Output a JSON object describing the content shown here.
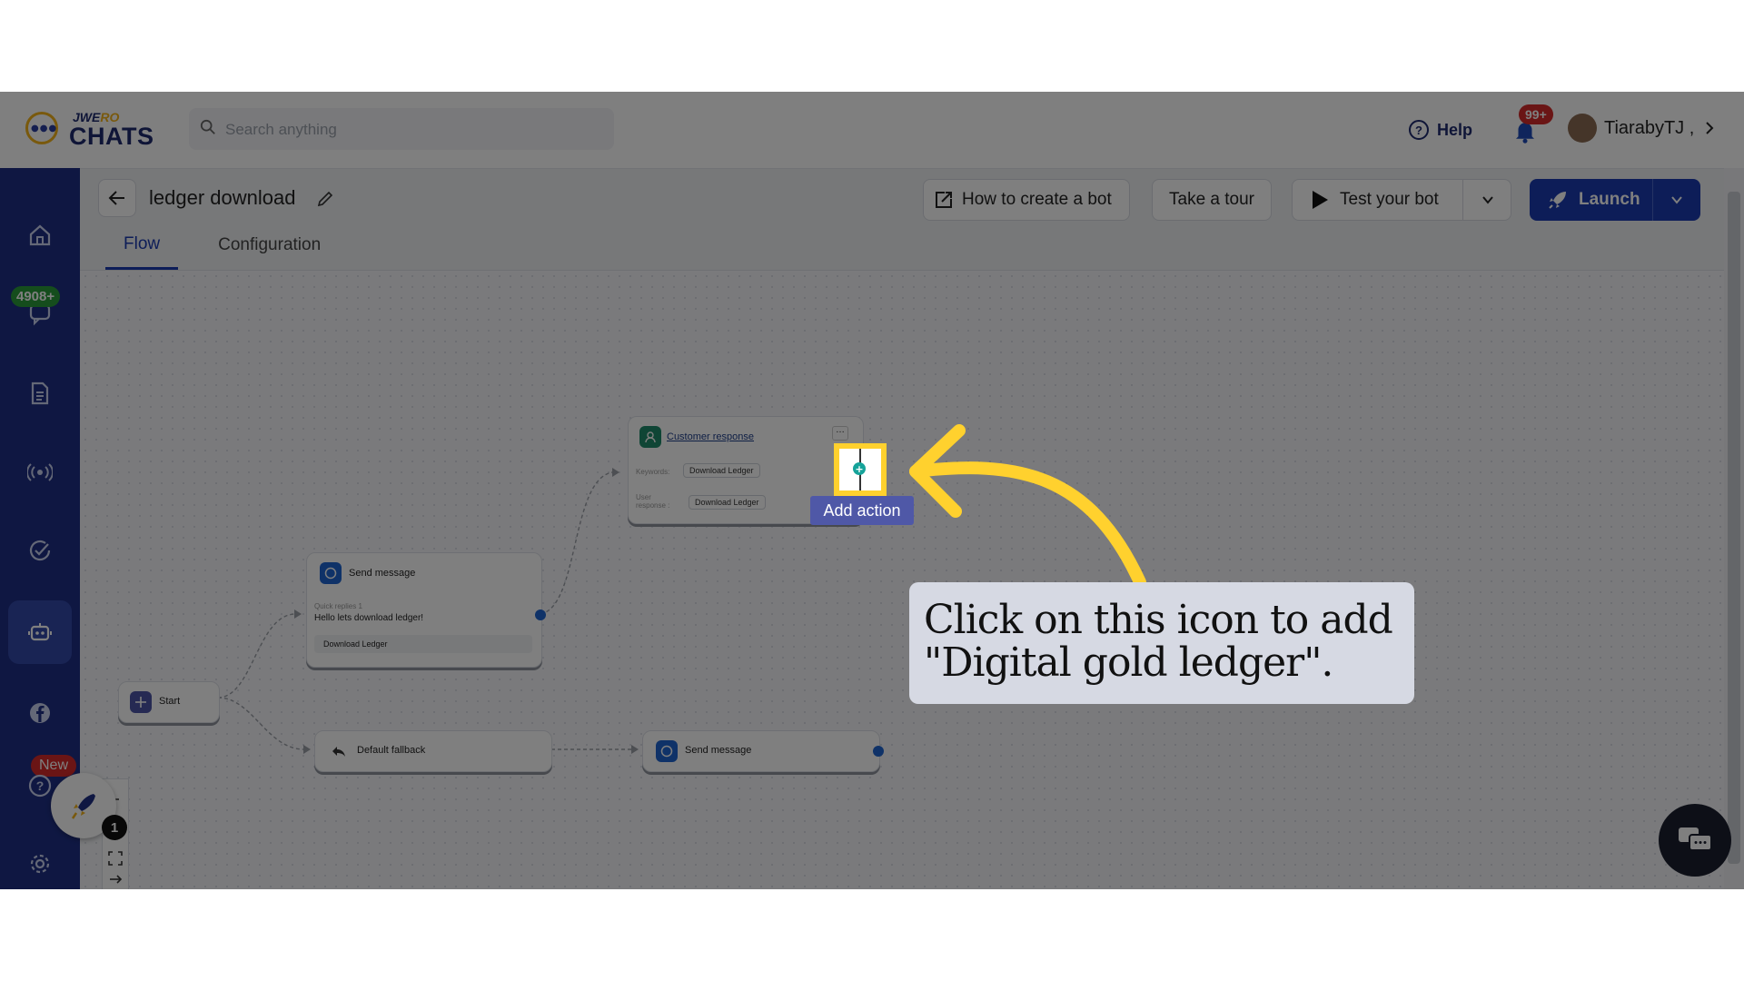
{
  "brand": {
    "top_left": "JWE",
    "top_right": "RO",
    "main": "CHATS"
  },
  "search": {
    "placeholder": "Search anything"
  },
  "header": {
    "help": "Help",
    "notifications_badge": "99+",
    "user_name": "TiarabyTJ ,"
  },
  "sidebar": {
    "items": [
      {
        "name": "home",
        "icon": "home-icon"
      },
      {
        "name": "chats",
        "icon": "chat-icon",
        "badge": "4908+"
      },
      {
        "name": "documents",
        "icon": "document-icon"
      },
      {
        "name": "broadcast",
        "icon": "broadcast-icon"
      },
      {
        "name": "tasks",
        "icon": "check-circle-icon"
      },
      {
        "name": "bots",
        "icon": "bot-icon",
        "active": true
      },
      {
        "name": "facebook",
        "icon": "facebook-icon",
        "badge": "New"
      },
      {
        "name": "help",
        "icon": "question-icon"
      },
      {
        "name": "settings",
        "icon": "gear-icon"
      }
    ]
  },
  "page": {
    "title": "ledger download"
  },
  "toolbar": {
    "how_to": "How to create a bot",
    "tour": "Take a tour",
    "test": "Test your bot",
    "launch": "Launch"
  },
  "tabs": [
    {
      "label": "Flow",
      "active": true
    },
    {
      "label": "Configuration",
      "active": false
    }
  ],
  "flow": {
    "start": {
      "label": "Start"
    },
    "send_message_1": {
      "title": "Send message",
      "sub": "Quick replies 1",
      "message": "Hello lets download ledger!",
      "button": "Download Ledger"
    },
    "customer_response": {
      "title": "Customer response",
      "keywords_label": "Keywords:",
      "keywords_value": "Download Ledger",
      "user_response_label": "User response :",
      "user_response_value": "Download Ledger"
    },
    "fallback": {
      "title": "Default fallback"
    },
    "send_message_2": {
      "title": "Send message"
    }
  },
  "widgets": {
    "rocket_count": "1"
  },
  "guide": {
    "tooltip": "Add action",
    "callout": "Click on this icon to add \"Digital gold ledger\".",
    "arrow_color": "#ffd12e"
  },
  "colors": {
    "sidebar": "#1e2f85",
    "accent": "#1a3bb0",
    "highlight": "#ffd12e"
  }
}
